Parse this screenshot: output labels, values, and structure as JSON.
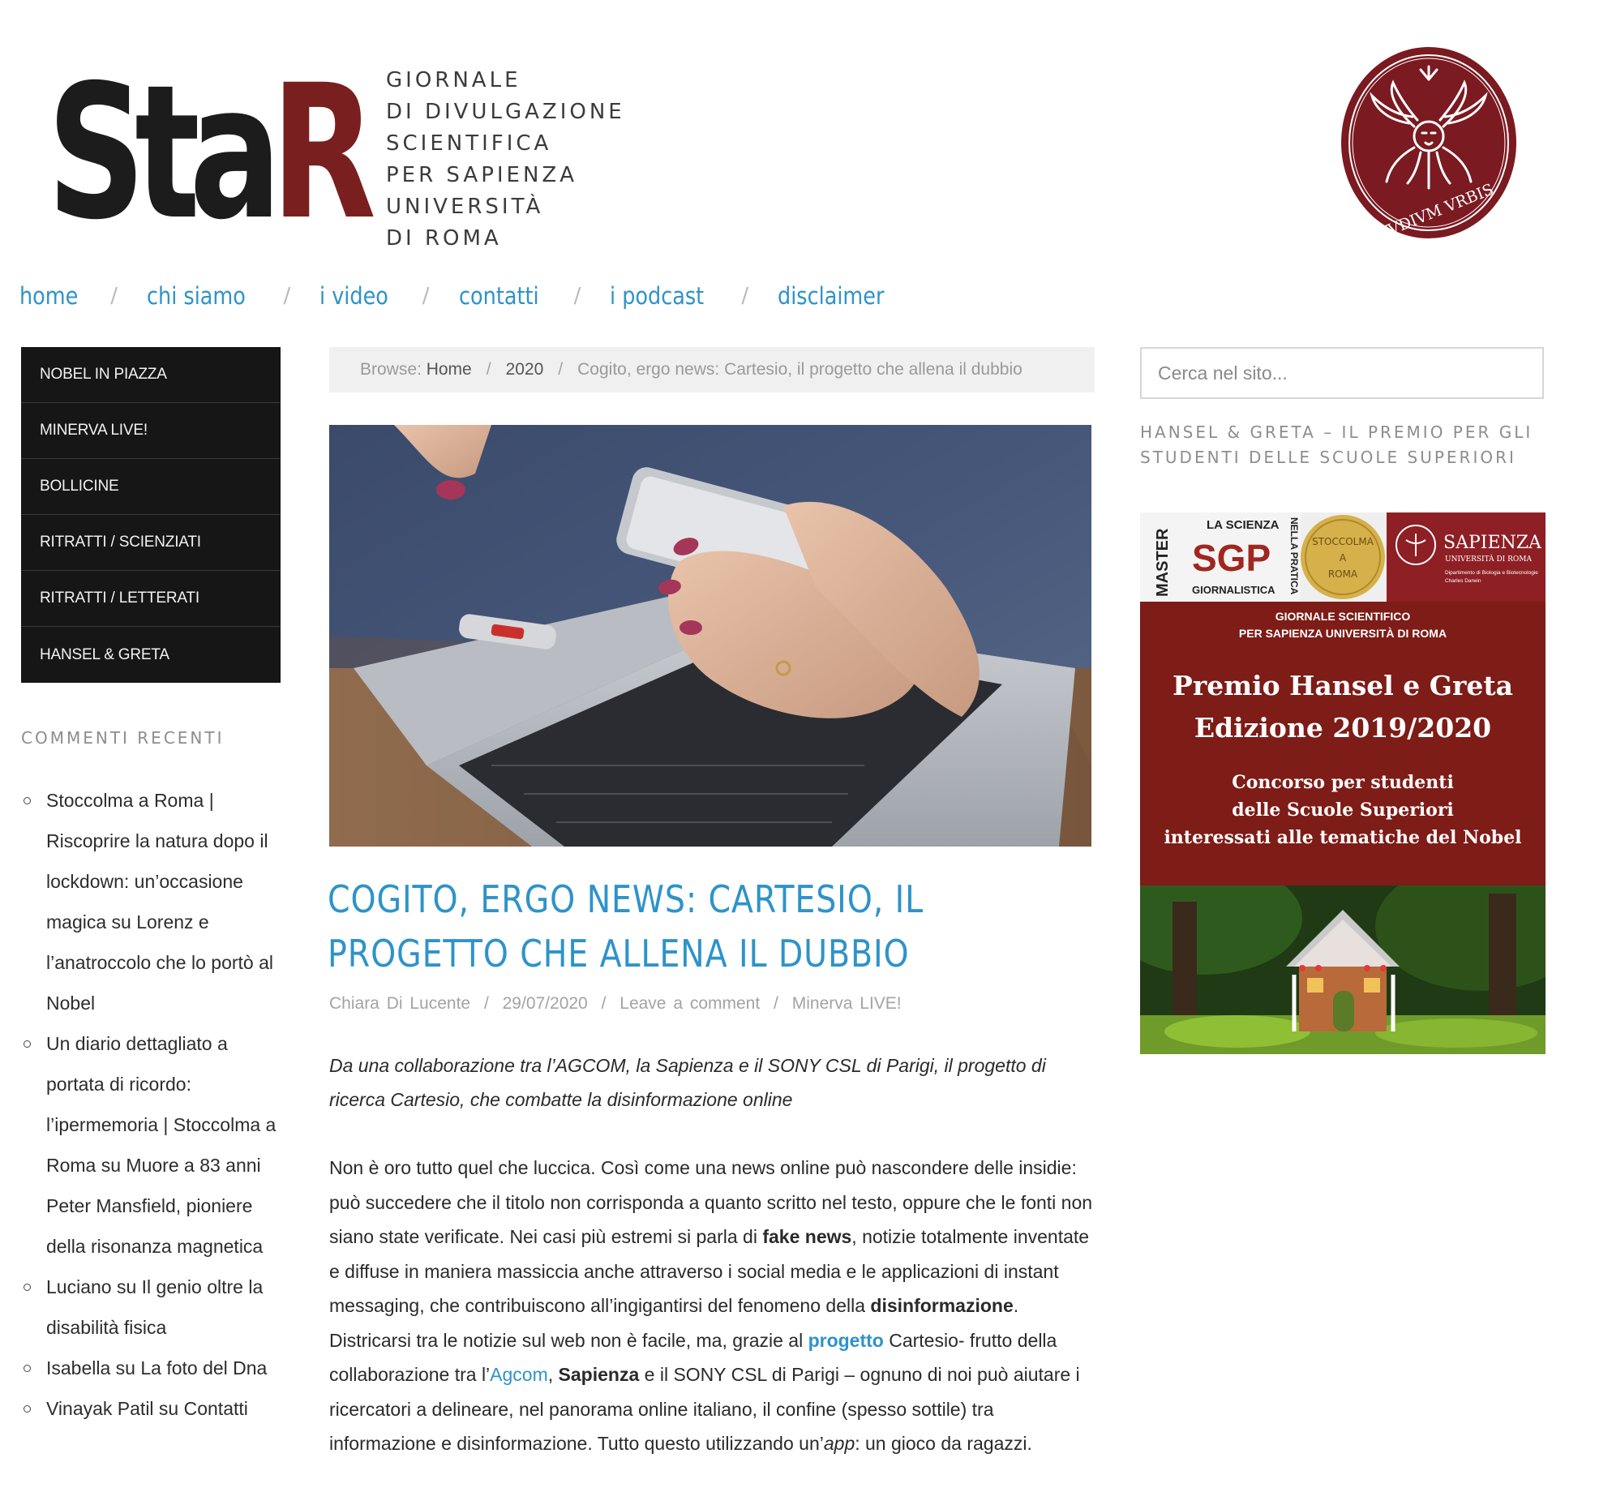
{
  "header": {
    "logo_text": "StaR",
    "tagline": [
      "GIORNALE",
      "DI DIVULGAZIONE",
      "SCIENTIFICA",
      "PER SAPIENZA",
      "UNIVERSITÀ",
      "DI ROMA"
    ],
    "seal_text": "STVDIVM VRBIS"
  },
  "nav": {
    "items": [
      {
        "label": "home"
      },
      {
        "label": "chi siamo"
      },
      {
        "label": "i video"
      },
      {
        "label": "contatti"
      },
      {
        "label": "i podcast"
      },
      {
        "label": "disclaimer"
      }
    ],
    "separator": "/"
  },
  "category_menu": [
    {
      "label": "NOBEL IN PIAZZA"
    },
    {
      "label": "MINERVA LIVE!"
    },
    {
      "label": "BOLLICINE"
    },
    {
      "label": "RITRATTI / SCIENZIATI"
    },
    {
      "label": "RITRATTI / LETTERATI"
    },
    {
      "label": "HANSEL & GRETA"
    }
  ],
  "recent_comments": {
    "title": "COMMENTI RECENTI",
    "items": [
      {
        "text": "Stoccolma a Roma | Riscoprire la natura dopo il lockdown: un’occasione magica su Lorenz e l’anatroccolo che lo portò al Nobel"
      },
      {
        "text": "Un diario dettagliato a portata di ricordo: l’ipermemoria | Stoccolma a Roma su Muore a 83 anni Peter Mansfield, pioniere della risonanza magnetica"
      },
      {
        "text": "Luciano su Il genio oltre la disabilità fisica"
      },
      {
        "text": "Isabella su La foto del Dna"
      },
      {
        "text": "Vinayak Patil su Contatti"
      }
    ]
  },
  "breadcrumb": {
    "prefix": "Browse:",
    "home": "Home",
    "year": "2020",
    "current": "Cogito, ergo news: Cartesio, il progetto che allena il dubbio",
    "separator": "/"
  },
  "article": {
    "title": "COGITO, ERGO NEWS: CARTESIO, IL PROGETTO CHE ALLENA IL DUBBIO",
    "meta": {
      "author": "Chiara Di Lucente",
      "date": "29/07/2020",
      "comments": "Leave a comment",
      "category": "Minerva LIVE!",
      "separator": "/"
    },
    "lead": "Da una collaborazione tra l’AGCOM, la Sapienza e il SONY CSL di Parigi, il progetto di ricerca Cartesio, che combatte la disinformazione online",
    "body": {
      "p1": "Non è oro tutto quel che luccica. Così come una news online può nascondere delle insidie: può succedere che il titolo non corrisponda a quanto scritto nel testo, oppure che le fonti non siano state verificate. Nei casi più estremi si parla di ",
      "fake_news": "fake news",
      "p2": ", notizie totalmente inventate e diffuse in maniera massiccia anche attraverso i social media e le applicazioni di instant messaging, che contribuiscono all’ingigantirsi del fenomeno della ",
      "disinformazione": "disinformazione",
      "p3": ". Districarsi tra le notizie sul web non è facile, ma, grazie al ",
      "progetto_link": "progetto",
      "p4": " Cartesio- frutto della collaborazione tra l’",
      "agcom_link": "Agcom",
      "p5": ", ",
      "sapienza": "Sapienza",
      "p6": " e il SONY CSL di Parigi –  ognuno di noi può aiutare i ricercatori a delineare, nel panorama online italiano, il confine (spesso sottile) tra informazione e disinformazione. Tutto questo utilizzando un’",
      "app": "app",
      "p7": ": un gioco da ragazzi."
    }
  },
  "sidebar": {
    "search_placeholder": "Cerca nel sito...",
    "widget_title": "HANSEL & GRETA – IL PREMIO PER GLI STUDENTI DELLE SCUOLE SUPERIORI",
    "banner": {
      "logo_master": "MASTER",
      "logo_la_scienza": "LA SCIENZA",
      "logo_nella_pratica": "NELLA PRATICA",
      "logo_sgp": "SGP",
      "logo_giornalistica": "GIORNALISTICA",
      "medal_line1": "STOCCOLMA",
      "medal_line2": "A",
      "medal_line3": "ROMA",
      "sapienza_name": "SAPIENZA",
      "sapienza_sub": "UNIVERSITÀ DI ROMA",
      "sapienza_dept1": "Dipartimento di Biologia e Biotecnologie",
      "sapienza_dept2": "Charles Darwin",
      "giornale_line1": "GIORNALE SCIENTIFICO",
      "giornale_line2": "PER SAPIENZA UNIVERSITÀ DI ROMA",
      "title_line1": "Premio Hansel e Greta",
      "title_line2": "Edizione 2019/2020",
      "caption_line1": "Concorso per studenti",
      "caption_line2": "delle Scuole Superiori",
      "caption_line3": "interessati alle tematiche del Nobel"
    }
  },
  "colors": {
    "link_blue": "#2e93c9",
    "logo_red": "#7a1f1f",
    "seal_red": "#7b1a21",
    "banner_red": "#7e1c17",
    "menu_bg": "#161616"
  }
}
